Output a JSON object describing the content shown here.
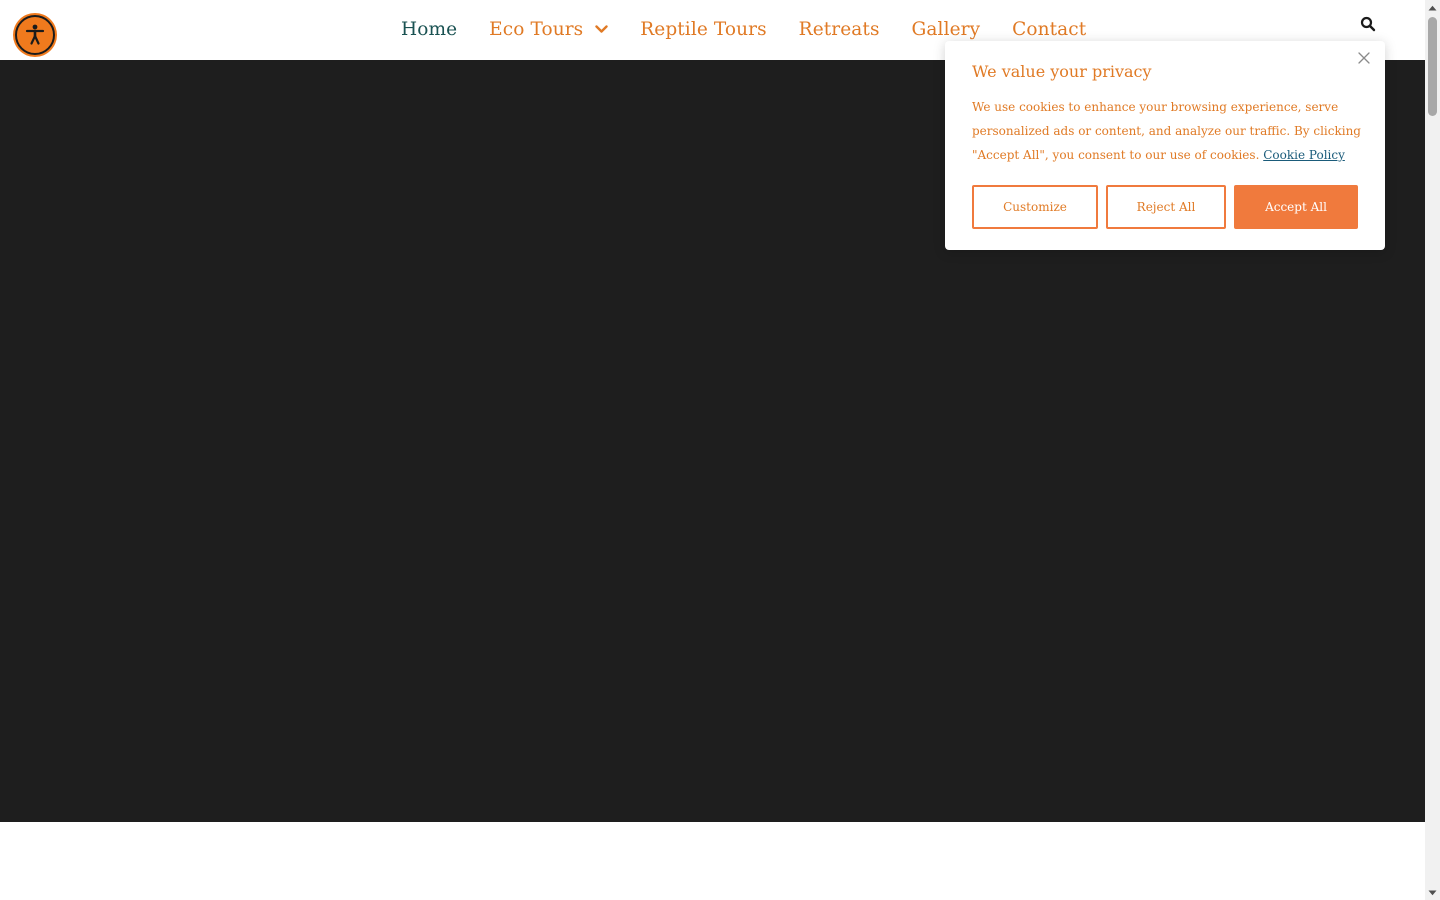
{
  "header": {
    "nav": [
      {
        "label": "Home"
      },
      {
        "label": "Eco Tours"
      },
      {
        "label": "Reptile Tours"
      },
      {
        "label": "Retreats"
      },
      {
        "label": "Gallery"
      },
      {
        "label": "Contact"
      }
    ]
  },
  "cookie_banner": {
    "title": "We value your privacy",
    "text": "We use cookies to enhance your browsing experience, serve personalized ads or content, and analyze our traffic. By clicking \"Accept All\", you consent to our use of cookies.",
    "policy_link": "Cookie Policy",
    "buttons": {
      "customize": "Customize",
      "reject": "Reject All",
      "accept": "Accept All"
    }
  },
  "colors": {
    "accent": "#e07a25",
    "active_nav": "#1a5252",
    "button_fill": "#f07a3d",
    "hero_background": "#1e1e1e",
    "link": "#1a5b7a"
  },
  "icons": {
    "accessibility": "accessibility-icon",
    "search": "search-icon",
    "close": "close-icon",
    "dropdown": "chevron-down-icon"
  }
}
